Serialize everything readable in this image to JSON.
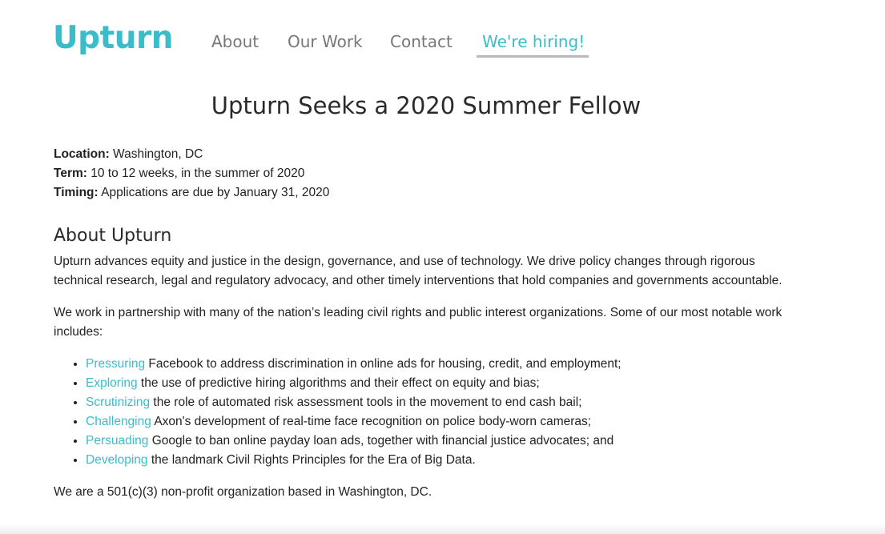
{
  "header": {
    "logo": "Upturn",
    "nav": [
      "About",
      "Our Work",
      "Contact",
      "We're hiring!"
    ],
    "active_nav": "We're hiring!"
  },
  "page": {
    "title": "Upturn Seeks a 2020 Summer Fellow",
    "meta": [
      {
        "label": "Location:",
        "value": " Washington, DC"
      },
      {
        "label": "Term:",
        "value": " 10 to 12 weeks, in the summer of 2020"
      },
      {
        "label": "Timing:",
        "value": " Applications are due by January 31, 2020"
      }
    ],
    "about_heading": "About Upturn",
    "paragraph1": "Upturn advances equity and justice in the design, governance, and use of technology. We drive policy changes through rigorous technical research, legal and regulatory advocacy, and other timely interventions that hold companies and governments accountable.",
    "paragraph2": "We work in partnership with many of the nation’s leading civil rights and public interest organizations. Some of our most notable work includes:",
    "work_items": [
      {
        "link": "Pressuring",
        "text": " Facebook to address discrimination in online ads for housing, credit, and employment;"
      },
      {
        "link": "Exploring",
        "text": " the use of predictive hiring algorithms and their effect on equity and bias;"
      },
      {
        "link": "Scrutinizing",
        "text": " the role of automated risk assessment tools in the movement to end cash bail;"
      },
      {
        "link": "Challenging",
        "text": " Axon's development of real-time face recognition on police body-worn cameras;"
      },
      {
        "link": "Persuading",
        "text": " Google to ban online payday loan ads, together with financial justice advocates; and"
      },
      {
        "link": "Developing",
        "text": " the landmark Civil Rights Principles for the Era of Big Data."
      }
    ],
    "paragraph3": "We are a 501(c)(3) non-profit organization based in Washington, DC."
  },
  "colors": {
    "brand": "#3cbcc9",
    "nav_text": "#777777",
    "body_text": "#222222",
    "active_underline": "#b9b9b9"
  }
}
